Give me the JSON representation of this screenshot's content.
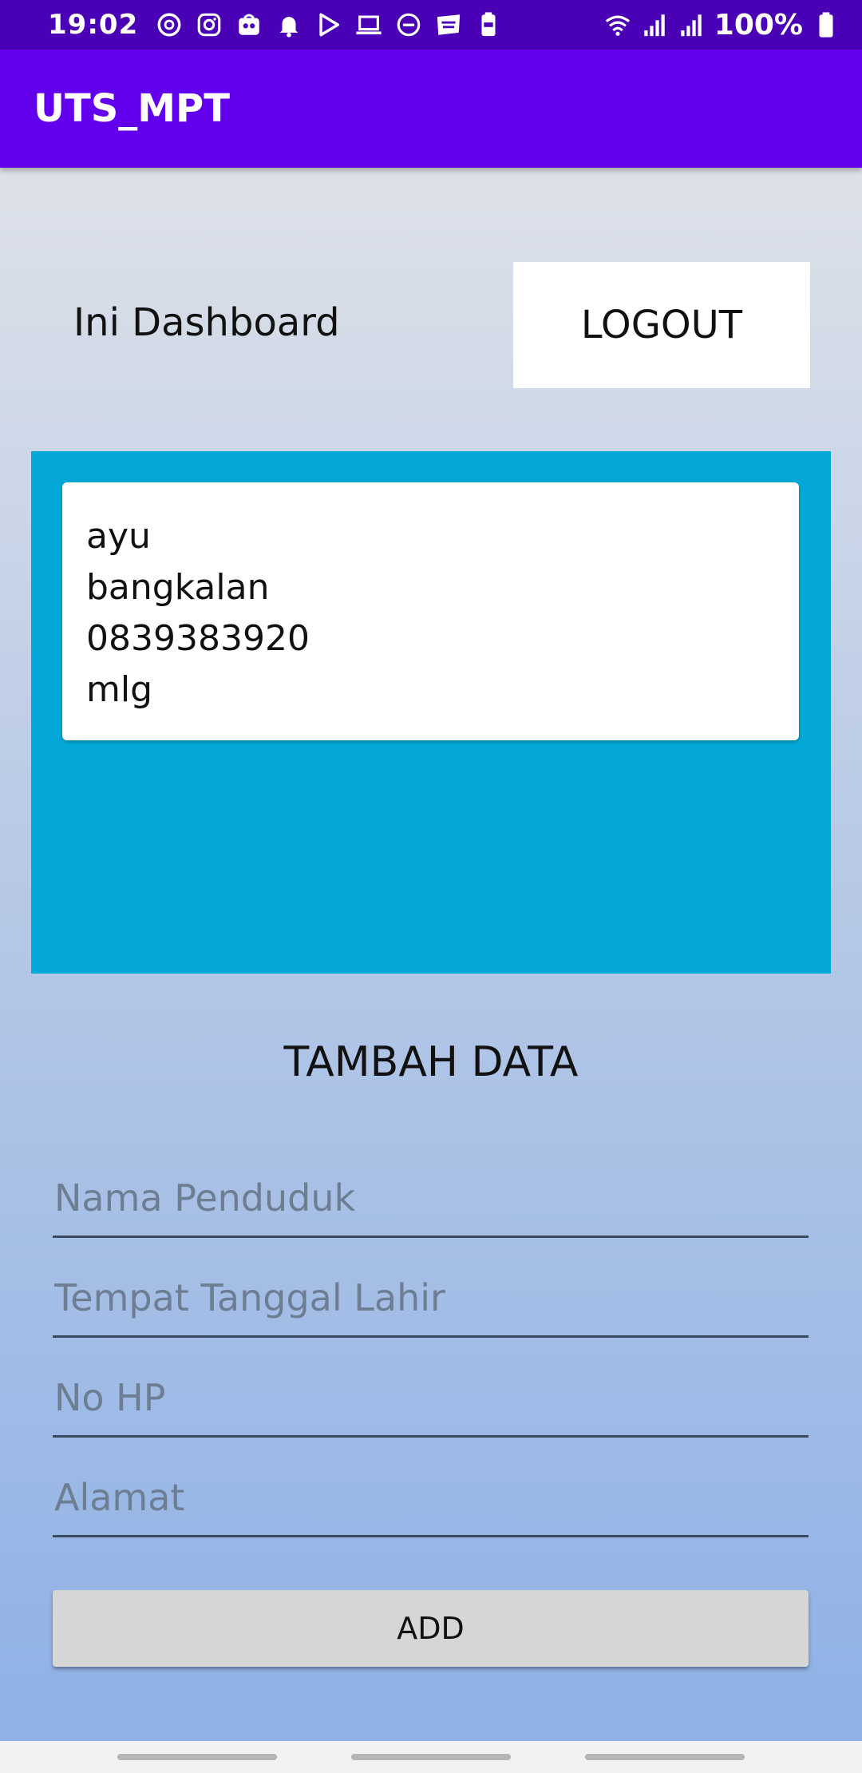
{
  "status_bar": {
    "time": "19:02",
    "battery_percent": "100%",
    "notification_icons": [
      "at-icon",
      "instagram-icon",
      "tokopedia-icon",
      "bell-icon",
      "play-store-icon",
      "laptop-icon",
      "dnd-icon",
      "webtoon-icon",
      "battery-saver-icon"
    ]
  },
  "app_bar": {
    "title": "UTS_MPT",
    "background": "#6200ee"
  },
  "dashboard": {
    "title": "Ini Dashboard",
    "logout_label": "LOGOUT"
  },
  "record_card": {
    "lines": [
      "ayu",
      "bangkalan",
      "0839383920",
      "mlg"
    ],
    "panel_color": "#03a8d8"
  },
  "form": {
    "title": "TAMBAH DATA",
    "fields": [
      {
        "placeholder": "Nama Penduduk",
        "value": ""
      },
      {
        "placeholder": "Tempat Tanggal Lahir",
        "value": ""
      },
      {
        "placeholder": "No HP",
        "value": ""
      },
      {
        "placeholder": "Alamat",
        "value": ""
      }
    ],
    "add_label": "ADD"
  }
}
